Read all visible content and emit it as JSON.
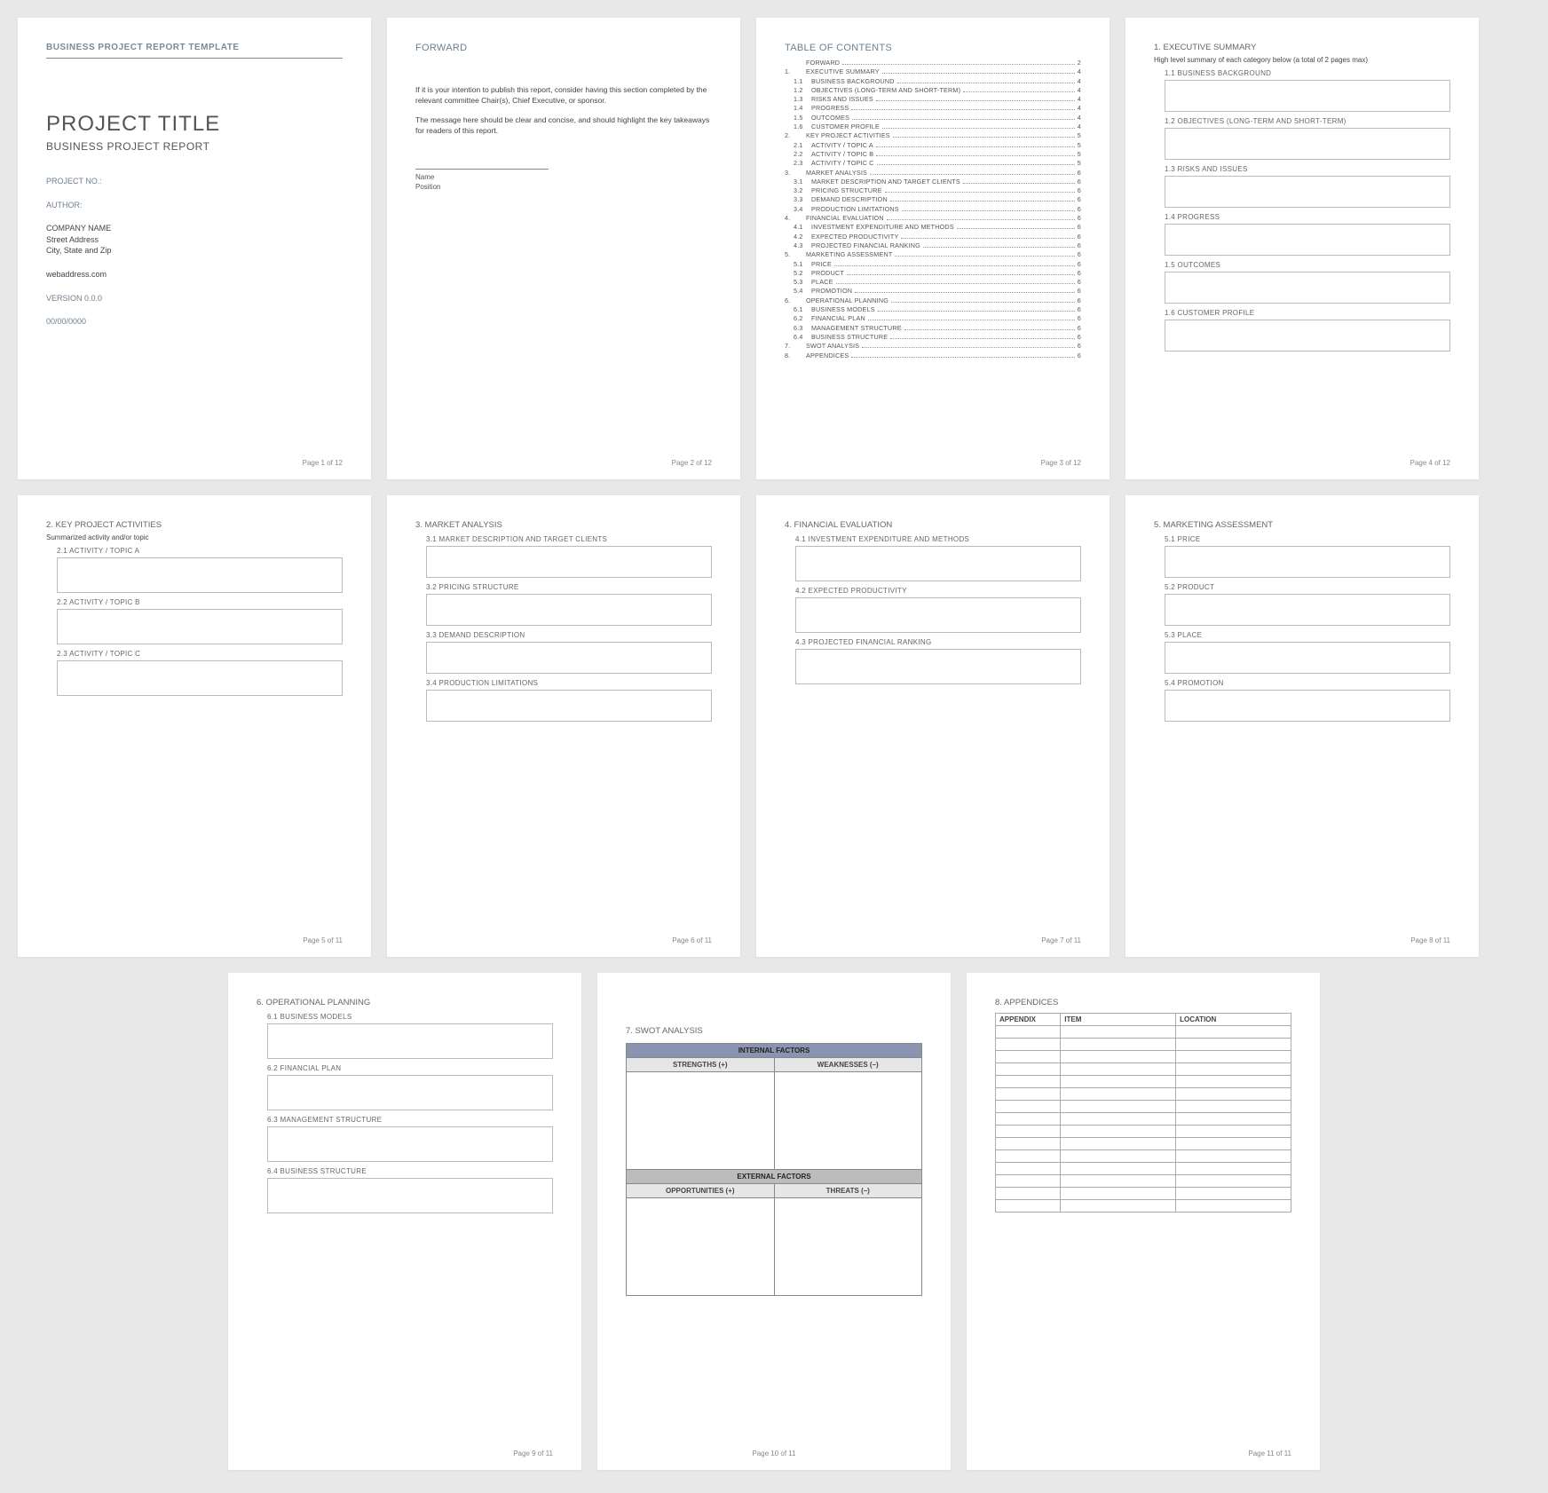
{
  "doc_header": "BUSINESS PROJECT REPORT TEMPLATE",
  "page1": {
    "title": "PROJECT TITLE",
    "subtitle": "BUSINESS PROJECT REPORT",
    "project_no": "PROJECT NO.:",
    "author": "AUTHOR:",
    "company": "COMPANY NAME",
    "street": "Street Address",
    "city": "City, State and Zip",
    "web": "webaddress.com",
    "version": "VERSION 0.0.0",
    "date": "00/00/0000",
    "footer": "Page 1 of 12"
  },
  "page2": {
    "heading": "FORWARD",
    "p1": "If it is your intention to publish this report, consider having this section completed by the relevant committee Chair(s), Chief Executive, or sponsor.",
    "p2": "The message here should be clear and concise, and should highlight the key takeaways for readers of this report.",
    "name": "Name",
    "position": "Position",
    "footer": "Page 2 of 12"
  },
  "page3": {
    "heading": "TABLE OF CONTENTS",
    "rows": [
      {
        "n": "",
        "t": "FORWARD",
        "p": "2",
        "sub": false
      },
      {
        "n": "1.",
        "t": "EXECUTIVE SUMMARY",
        "p": "4",
        "sub": false
      },
      {
        "n": "1.1",
        "t": "BUSINESS BACKGROUND",
        "p": "4",
        "sub": true
      },
      {
        "n": "1.2",
        "t": "OBJECTIVES (LONG-TERM AND SHORT-TERM)",
        "p": "4",
        "sub": true
      },
      {
        "n": "1.3",
        "t": "RISKS AND ISSUES",
        "p": "4",
        "sub": true
      },
      {
        "n": "1.4",
        "t": "PROGRESS",
        "p": "4",
        "sub": true
      },
      {
        "n": "1.5",
        "t": "OUTCOMES",
        "p": "4",
        "sub": true
      },
      {
        "n": "1.6",
        "t": "CUSTOMER PROFILE",
        "p": "4",
        "sub": true
      },
      {
        "n": "2.",
        "t": "KEY PROJECT ACTIVITIES",
        "p": "5",
        "sub": false
      },
      {
        "n": "2.1",
        "t": "ACTIVITY / TOPIC A",
        "p": "5",
        "sub": true
      },
      {
        "n": "2.2",
        "t": "ACTIVITY / TOPIC B",
        "p": "5",
        "sub": true
      },
      {
        "n": "2.3",
        "t": "ACTIVITY / TOPIC C",
        "p": "5",
        "sub": true
      },
      {
        "n": "3.",
        "t": "MARKET ANALYSIS",
        "p": "6",
        "sub": false
      },
      {
        "n": "3.1",
        "t": "MARKET DESCRIPTION AND TARGET CLIENTS",
        "p": "6",
        "sub": true
      },
      {
        "n": "3.2",
        "t": "PRICING STRUCTURE",
        "p": "6",
        "sub": true
      },
      {
        "n": "3.3",
        "t": "DEMAND DESCRIPTION",
        "p": "6",
        "sub": true
      },
      {
        "n": "3.4",
        "t": "PRODUCTION LIMITATIONS",
        "p": "6",
        "sub": true
      },
      {
        "n": "4.",
        "t": "FINANCIAL EVALUATION",
        "p": "6",
        "sub": false
      },
      {
        "n": "4.1",
        "t": "INVESTMENT EXPENDITURE AND METHODS",
        "p": "6",
        "sub": true
      },
      {
        "n": "4.2",
        "t": "EXPECTED PRODUCTIVITY",
        "p": "6",
        "sub": true
      },
      {
        "n": "4.3",
        "t": "PROJECTED FINANCIAL RANKING",
        "p": "6",
        "sub": true
      },
      {
        "n": "5.",
        "t": "MARKETING ASSESSMENT",
        "p": "6",
        "sub": false
      },
      {
        "n": "5.1",
        "t": "PRICE",
        "p": "6",
        "sub": true
      },
      {
        "n": "5.2",
        "t": "PRODUCT",
        "p": "6",
        "sub": true
      },
      {
        "n": "5.3",
        "t": "PLACE",
        "p": "6",
        "sub": true
      },
      {
        "n": "5.4",
        "t": "PROMOTION",
        "p": "6",
        "sub": true
      },
      {
        "n": "6.",
        "t": "OPERATIONAL PLANNING",
        "p": "6",
        "sub": false
      },
      {
        "n": "6.1",
        "t": "BUSINESS MODELS",
        "p": "6",
        "sub": true
      },
      {
        "n": "6.2",
        "t": "FINANCIAL PLAN",
        "p": "6",
        "sub": true
      },
      {
        "n": "6.3",
        "t": "MANAGEMENT STRUCTURE",
        "p": "6",
        "sub": true
      },
      {
        "n": "6.4",
        "t": "BUSINESS STRUCTURE",
        "p": "6",
        "sub": true
      },
      {
        "n": "7.",
        "t": "SWOT ANALYSIS",
        "p": "6",
        "sub": false
      },
      {
        "n": "8.",
        "t": "APPENDICES",
        "p": "6",
        "sub": false
      }
    ],
    "footer": "Page 3 of 12"
  },
  "page4": {
    "heading": "1.  EXECUTIVE SUMMARY",
    "caption": "High level summary of each category below (a total of 2 pages max)",
    "subs": [
      "1.1   BUSINESS BACKGROUND",
      "1.2   OBJECTIVES (LONG-TERM AND SHORT-TERM)",
      "1.3   RISKS AND ISSUES",
      "1.4   PROGRESS",
      "1.5   OUTCOMES",
      "1.6   CUSTOMER PROFILE"
    ],
    "footer": "Page 4 of 12"
  },
  "page5": {
    "heading": "2.  KEY PROJECT ACTIVITIES",
    "caption": "Summarized activity and/or topic",
    "subs": [
      "2.1   ACTIVITY / TOPIC A",
      "2.2   ACTIVITY / TOPIC B",
      "2.3   ACTIVITY / TOPIC C"
    ],
    "footer": "Page 5 of 11"
  },
  "page6": {
    "heading": "3.  MARKET ANALYSIS",
    "subs": [
      "3.1   MARKET DESCRIPTION AND TARGET CLIENTS",
      "3.2   PRICING STRUCTURE",
      "3.3   DEMAND DESCRIPTION",
      "3.4   PRODUCTION LIMITATIONS"
    ],
    "footer": "Page 6 of 11"
  },
  "page7": {
    "heading": "4.  FINANCIAL EVALUATION",
    "subs": [
      "4.1   INVESTMENT EXPENDITURE AND METHODS",
      "4.2   EXPECTED PRODUCTIVITY",
      "4.3   PROJECTED FINANCIAL RANKING"
    ],
    "footer": "Page 7 of 11"
  },
  "page8": {
    "heading": "5.  MARKETING ASSESSMENT",
    "subs": [
      "5.1   PRICE",
      "5.2   PRODUCT",
      "5.3   PLACE",
      "5.4   PROMOTION"
    ],
    "footer": "Page 8 of 11"
  },
  "page9": {
    "heading": "6.  OPERATIONAL PLANNING",
    "subs": [
      "6.1   BUSINESS MODELS",
      "6.2   FINANCIAL PLAN",
      "6.3   MANAGEMENT STRUCTURE",
      "6.4   BUSINESS STRUCTURE"
    ],
    "footer": "Page 9 of 11"
  },
  "page10": {
    "heading": "7.  SWOT ANALYSIS",
    "internal": "INTERNAL FACTORS",
    "external": "EXTERNAL FACTORS",
    "strengths": "STRENGTHS (+)",
    "weaknesses": "WEAKNESSES (–)",
    "opportunities": "OPPORTUNITIES (+)",
    "threats": "THREATS (–)",
    "footer": "Page 10 of 11"
  },
  "page11": {
    "heading": "8.  APPENDICES",
    "cols": [
      "APPENDIX",
      "ITEM",
      "LOCATION"
    ],
    "rows": 15,
    "footer": "Page 11 of 11"
  }
}
